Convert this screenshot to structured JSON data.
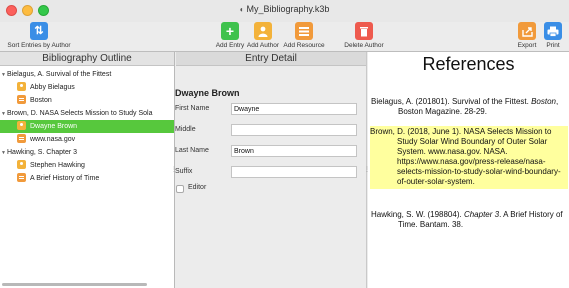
{
  "window": {
    "title": "My_Bibliography.k3b"
  },
  "toolbar": {
    "sort_label": "Sort Entries by Author",
    "add_entry_label": "Add Entry",
    "add_author_label": "Add Author",
    "add_resource_label": "Add Resource",
    "delete_author_label": "Delete Author",
    "export_label": "Export",
    "print_label": "Print",
    "colors": {
      "sort": "#3a8ee6",
      "add_entry": "#3fc24d",
      "add_author": "#f3b23a",
      "add_resource": "#f19a3b",
      "delete": "#ee5a4e",
      "export": "#f19a3b",
      "print": "#3a8ee6"
    }
  },
  "outline": {
    "header": "Bibliography Outline",
    "items": [
      {
        "label": "Bielagus, A. Survival of the Fittest",
        "type": "group"
      },
      {
        "label": "Abby Bielagus",
        "type": "author"
      },
      {
        "label": "Boston",
        "type": "resource"
      },
      {
        "label": "Brown, D. NASA Selects Mission to Study Sola",
        "type": "group"
      },
      {
        "label": "Dwayne Brown",
        "type": "author",
        "selected": true
      },
      {
        "label": "www.nasa.gov",
        "type": "resource"
      },
      {
        "label": "Hawking, S. Chapter 3",
        "type": "group"
      },
      {
        "label": "Stephen Hawking",
        "type": "author"
      },
      {
        "label": "A Brief History of Time",
        "type": "resource"
      }
    ]
  },
  "detail": {
    "header": "Entry Detail",
    "title": "Dwayne Brown",
    "fields": {
      "first_name_label": "First Name",
      "first_name_value": "Dwayne",
      "middle_label": "Middle",
      "middle_value": "",
      "last_name_label": "Last Name",
      "last_name_value": "Brown",
      "suffix_label": "Suffix",
      "suffix_value": ""
    },
    "editor_label": "Editor"
  },
  "references": {
    "title": "References",
    "entries": [
      {
        "before": "Bielagus, A. (201801). Survival of the Fittest. ",
        "italic": "Boston",
        "after": ", Boston Magazine. 28-29."
      },
      {
        "before": "Brown, D. (2018, June 1). NASA Selects Mission to Study Solar Wind Boundary of Outer Solar System. www.nasa.gov. NASA. https://www.nasa.gov/press-release/nasa-selects-mission-to-study-solar-wind-boundary-of-outer-solar-system.",
        "italic": "",
        "after": ""
      },
      {
        "before": "Hawking, S. W. (198804). ",
        "italic": "Chapter 3",
        "after": ". A Brief History of Time. Bantam. 38."
      }
    ]
  }
}
